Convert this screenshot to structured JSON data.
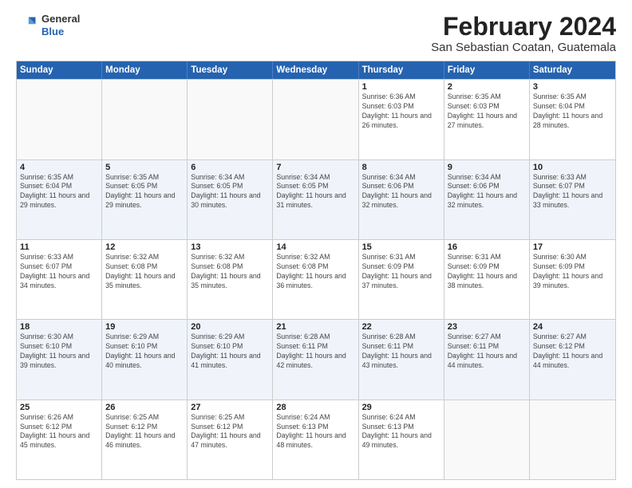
{
  "logo": {
    "general": "General",
    "blue": "Blue"
  },
  "title": "February 2024",
  "subtitle": "San Sebastian Coatan, Guatemala",
  "days_of_week": [
    "Sunday",
    "Monday",
    "Tuesday",
    "Wednesday",
    "Thursday",
    "Friday",
    "Saturday"
  ],
  "weeks": [
    [
      {
        "day": "",
        "info": ""
      },
      {
        "day": "",
        "info": ""
      },
      {
        "day": "",
        "info": ""
      },
      {
        "day": "",
        "info": ""
      },
      {
        "day": "1",
        "info": "Sunrise: 6:36 AM\nSunset: 6:03 PM\nDaylight: 11 hours and 26 minutes."
      },
      {
        "day": "2",
        "info": "Sunrise: 6:35 AM\nSunset: 6:03 PM\nDaylight: 11 hours and 27 minutes."
      },
      {
        "day": "3",
        "info": "Sunrise: 6:35 AM\nSunset: 6:04 PM\nDaylight: 11 hours and 28 minutes."
      }
    ],
    [
      {
        "day": "4",
        "info": "Sunrise: 6:35 AM\nSunset: 6:04 PM\nDaylight: 11 hours and 29 minutes."
      },
      {
        "day": "5",
        "info": "Sunrise: 6:35 AM\nSunset: 6:05 PM\nDaylight: 11 hours and 29 minutes."
      },
      {
        "day": "6",
        "info": "Sunrise: 6:34 AM\nSunset: 6:05 PM\nDaylight: 11 hours and 30 minutes."
      },
      {
        "day": "7",
        "info": "Sunrise: 6:34 AM\nSunset: 6:05 PM\nDaylight: 11 hours and 31 minutes."
      },
      {
        "day": "8",
        "info": "Sunrise: 6:34 AM\nSunset: 6:06 PM\nDaylight: 11 hours and 32 minutes."
      },
      {
        "day": "9",
        "info": "Sunrise: 6:34 AM\nSunset: 6:06 PM\nDaylight: 11 hours and 32 minutes."
      },
      {
        "day": "10",
        "info": "Sunrise: 6:33 AM\nSunset: 6:07 PM\nDaylight: 11 hours and 33 minutes."
      }
    ],
    [
      {
        "day": "11",
        "info": "Sunrise: 6:33 AM\nSunset: 6:07 PM\nDaylight: 11 hours and 34 minutes."
      },
      {
        "day": "12",
        "info": "Sunrise: 6:32 AM\nSunset: 6:08 PM\nDaylight: 11 hours and 35 minutes."
      },
      {
        "day": "13",
        "info": "Sunrise: 6:32 AM\nSunset: 6:08 PM\nDaylight: 11 hours and 35 minutes."
      },
      {
        "day": "14",
        "info": "Sunrise: 6:32 AM\nSunset: 6:08 PM\nDaylight: 11 hours and 36 minutes."
      },
      {
        "day": "15",
        "info": "Sunrise: 6:31 AM\nSunset: 6:09 PM\nDaylight: 11 hours and 37 minutes."
      },
      {
        "day": "16",
        "info": "Sunrise: 6:31 AM\nSunset: 6:09 PM\nDaylight: 11 hours and 38 minutes."
      },
      {
        "day": "17",
        "info": "Sunrise: 6:30 AM\nSunset: 6:09 PM\nDaylight: 11 hours and 39 minutes."
      }
    ],
    [
      {
        "day": "18",
        "info": "Sunrise: 6:30 AM\nSunset: 6:10 PM\nDaylight: 11 hours and 39 minutes."
      },
      {
        "day": "19",
        "info": "Sunrise: 6:29 AM\nSunset: 6:10 PM\nDaylight: 11 hours and 40 minutes."
      },
      {
        "day": "20",
        "info": "Sunrise: 6:29 AM\nSunset: 6:10 PM\nDaylight: 11 hours and 41 minutes."
      },
      {
        "day": "21",
        "info": "Sunrise: 6:28 AM\nSunset: 6:11 PM\nDaylight: 11 hours and 42 minutes."
      },
      {
        "day": "22",
        "info": "Sunrise: 6:28 AM\nSunset: 6:11 PM\nDaylight: 11 hours and 43 minutes."
      },
      {
        "day": "23",
        "info": "Sunrise: 6:27 AM\nSunset: 6:11 PM\nDaylight: 11 hours and 44 minutes."
      },
      {
        "day": "24",
        "info": "Sunrise: 6:27 AM\nSunset: 6:12 PM\nDaylight: 11 hours and 44 minutes."
      }
    ],
    [
      {
        "day": "25",
        "info": "Sunrise: 6:26 AM\nSunset: 6:12 PM\nDaylight: 11 hours and 45 minutes."
      },
      {
        "day": "26",
        "info": "Sunrise: 6:25 AM\nSunset: 6:12 PM\nDaylight: 11 hours and 46 minutes."
      },
      {
        "day": "27",
        "info": "Sunrise: 6:25 AM\nSunset: 6:12 PM\nDaylight: 11 hours and 47 minutes."
      },
      {
        "day": "28",
        "info": "Sunrise: 6:24 AM\nSunset: 6:13 PM\nDaylight: 11 hours and 48 minutes."
      },
      {
        "day": "29",
        "info": "Sunrise: 6:24 AM\nSunset: 6:13 PM\nDaylight: 11 hours and 49 minutes."
      },
      {
        "day": "",
        "info": ""
      },
      {
        "day": "",
        "info": ""
      }
    ]
  ],
  "alt_row_indices": [
    1,
    3
  ],
  "empty_cells_week0": [
    0,
    1,
    2,
    3
  ],
  "empty_cells_week4": [
    5,
    6
  ]
}
